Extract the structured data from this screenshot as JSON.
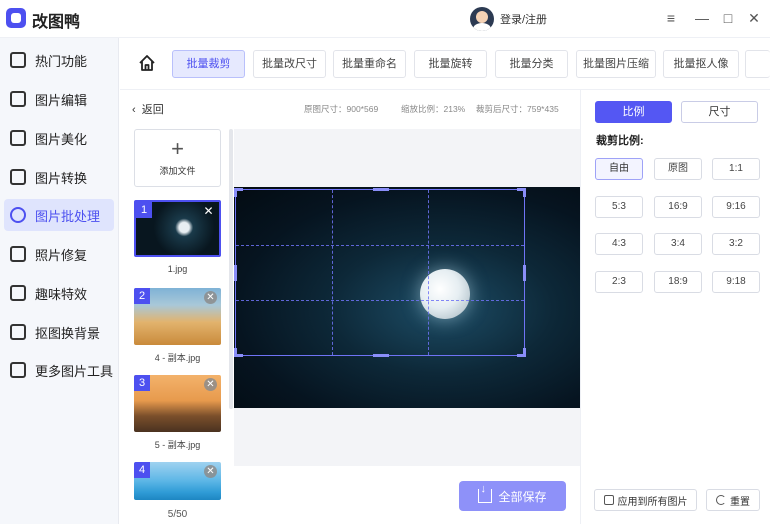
{
  "app": {
    "title": "改图鸭",
    "login_label": "登录/注册"
  },
  "window_controls": [
    "≡",
    "—",
    "□",
    "✕"
  ],
  "sidebar": {
    "items": [
      {
        "label": "热门功能",
        "icon": "flame-icon"
      },
      {
        "label": "图片编辑",
        "icon": "image-edit-icon"
      },
      {
        "label": "图片美化",
        "icon": "image-beautify-icon"
      },
      {
        "label": "图片转换",
        "icon": "image-convert-icon"
      },
      {
        "label": "图片批处理",
        "icon": "batch-icon",
        "active": true
      },
      {
        "label": "照片修复",
        "icon": "photo-repair-icon"
      },
      {
        "label": "趣味特效",
        "icon": "magic-icon"
      },
      {
        "label": "抠图换背景",
        "icon": "cutout-icon"
      },
      {
        "label": "更多图片工具",
        "icon": "toolbox-icon"
      }
    ]
  },
  "tabs": [
    {
      "label": "批量裁剪",
      "active": true
    },
    {
      "label": "批量改尺寸"
    },
    {
      "label": "批量重命名"
    },
    {
      "label": "批量旋转"
    },
    {
      "label": "批量分类"
    },
    {
      "label": "批量图片压缩"
    },
    {
      "label": "批量抠人像"
    }
  ],
  "toolbar": {
    "back_label": "返回",
    "original_size": "原图尺寸：900*569",
    "zoom_ratio": "缩放比例：213%",
    "cropped_size": "裁剪后尺寸：759*435"
  },
  "file_list": {
    "add_label": "添加文件",
    "add_icon": "plus-icon",
    "items": [
      {
        "num": "1",
        "caption": "1.jpg",
        "selected": true
      },
      {
        "num": "2",
        "caption": "4 - 副本.jpg"
      },
      {
        "num": "3",
        "caption": "5 - 副本.jpg"
      },
      {
        "num": "4",
        "caption": ""
      }
    ],
    "counter": "5/50"
  },
  "save_all_label": "全部保存",
  "right_panel": {
    "mode_ratio": "比例",
    "mode_size": "尺寸",
    "ratio_title": "裁剪比例:",
    "ratios": [
      "自由",
      "原图",
      "1:1",
      "5:3",
      "16:9",
      "9:16",
      "4:3",
      "3:4",
      "3:2",
      "2:3",
      "18:9",
      "9:18"
    ],
    "selected_ratio": "自由",
    "apply_all_label": "应用到所有图片",
    "reset_label": "重置"
  },
  "colors": {
    "accent": "#4d50f0",
    "save_button": "#8e91f9",
    "crop_frame": "#6f73f5"
  }
}
